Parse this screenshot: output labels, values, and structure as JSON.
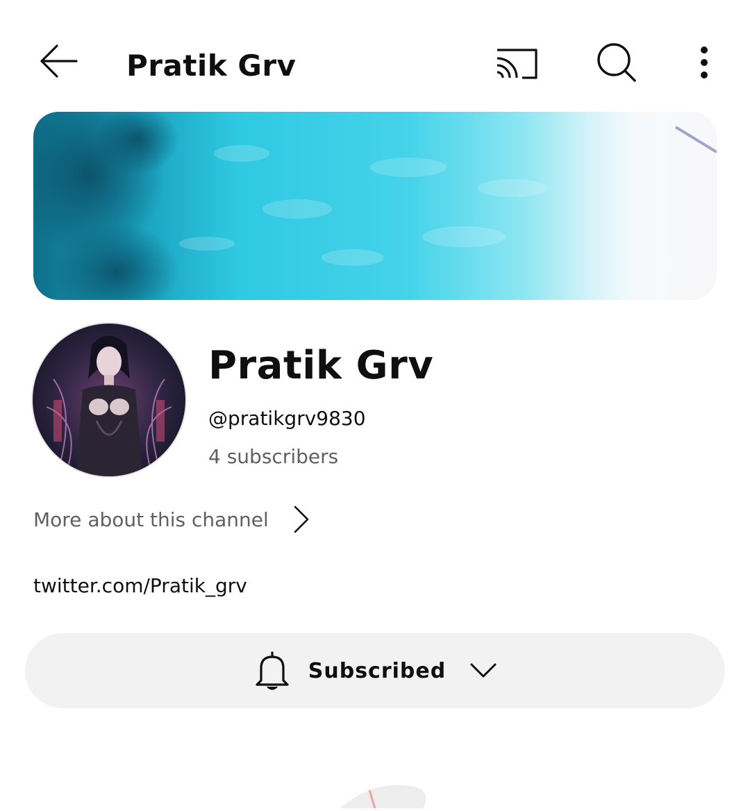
{
  "header": {
    "title": "Pratik Grv",
    "back_icon": "arrow-left-icon",
    "cast_icon": "cast-icon",
    "search_icon": "search-icon",
    "more_icon": "more-vertical-icon"
  },
  "channel": {
    "name": "Pratik Grv",
    "handle": "@pratikgrv9830",
    "subscribers": "4 subscribers",
    "more_about_label": "More about this channel",
    "link": "twitter.com/Pratik_grv"
  },
  "subscribe": {
    "label": "Subscribed",
    "bell_icon": "bell-icon",
    "chevron_icon": "chevron-down-icon"
  },
  "colors": {
    "text_primary": "#0f0f0f",
    "text_secondary": "#606060",
    "button_bg": "#f2f2f2",
    "banner_water": "#3fd0e6"
  }
}
